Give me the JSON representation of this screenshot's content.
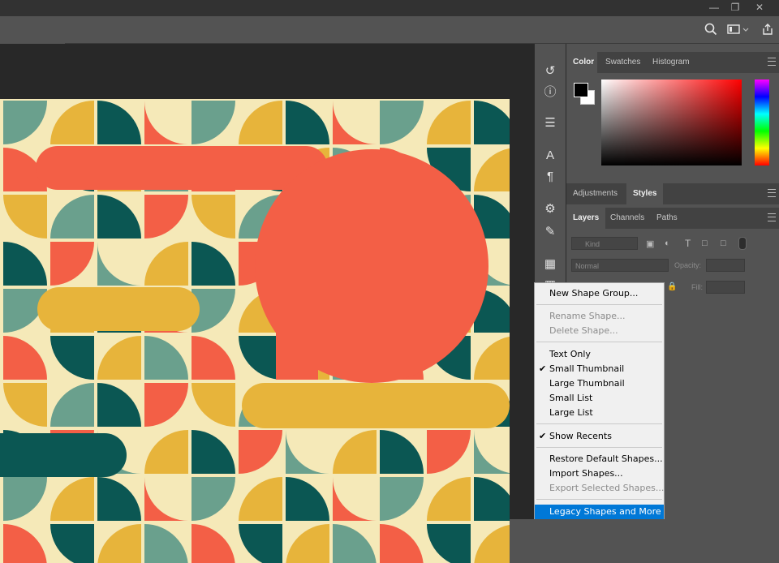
{
  "window": {
    "minimize_icon": "minimize-icon",
    "restore_icon": "restore-icon",
    "close_icon": "close-icon"
  },
  "options_bar": {
    "icons": [
      "search-icon",
      "workspace-icon",
      "share-icon"
    ]
  },
  "toolstrip": {
    "icons": [
      "history-icon",
      "info-icon",
      "brush-presets-icon",
      "character-icon",
      "paragraph-icon",
      "properties-icon",
      "brush-settings-icon",
      "libraries-icon",
      "layer-comps-icon"
    ]
  },
  "color_panel": {
    "tabs": [
      "Color",
      "Swatches",
      "Histogram"
    ],
    "active_tab": "Color",
    "foreground_color": "#000000",
    "background_color": "#ffffff",
    "hue": "#ff0000"
  },
  "adjustments_panel": {
    "tabs": [
      "Adjustments",
      "Styles"
    ],
    "active_tab": "Styles"
  },
  "layers_panel": {
    "tabs": [
      "Layers",
      "Channels",
      "Paths"
    ],
    "active_tab": "Layers",
    "filter_placeholder": "Kind",
    "blend_mode": "Normal",
    "opacity_label": "Opacity:",
    "fill_label": "Fill:"
  },
  "context_menu": {
    "groups": [
      [
        {
          "label": "New Shape Group...",
          "enabled": true,
          "checked": false
        }
      ],
      [
        {
          "label": "Rename Shape...",
          "enabled": false,
          "checked": false
        },
        {
          "label": "Delete Shape...",
          "enabled": false,
          "checked": false
        }
      ],
      [
        {
          "label": "Text Only",
          "enabled": true,
          "checked": false
        },
        {
          "label": "Small Thumbnail",
          "enabled": true,
          "checked": true
        },
        {
          "label": "Large Thumbnail",
          "enabled": true,
          "checked": false
        },
        {
          "label": "Small List",
          "enabled": true,
          "checked": false
        },
        {
          "label": "Large List",
          "enabled": true,
          "checked": false
        }
      ],
      [
        {
          "label": "Show Recents",
          "enabled": true,
          "checked": true
        }
      ],
      [
        {
          "label": "Restore Default Shapes...",
          "enabled": true,
          "checked": false
        },
        {
          "label": "Import Shapes...",
          "enabled": true,
          "checked": false
        },
        {
          "label": "Export Selected Shapes...",
          "enabled": false,
          "checked": false
        }
      ],
      [
        {
          "label": "Legacy Shapes and More",
          "enabled": true,
          "checked": false,
          "highlighted": true
        }
      ]
    ]
  },
  "canvas": {
    "palette": {
      "cream": "#f5e9b8",
      "teal": "#0b5753",
      "sage": "#6aa08d",
      "coral": "#f35f46",
      "mustard": "#e7b43b"
    }
  }
}
